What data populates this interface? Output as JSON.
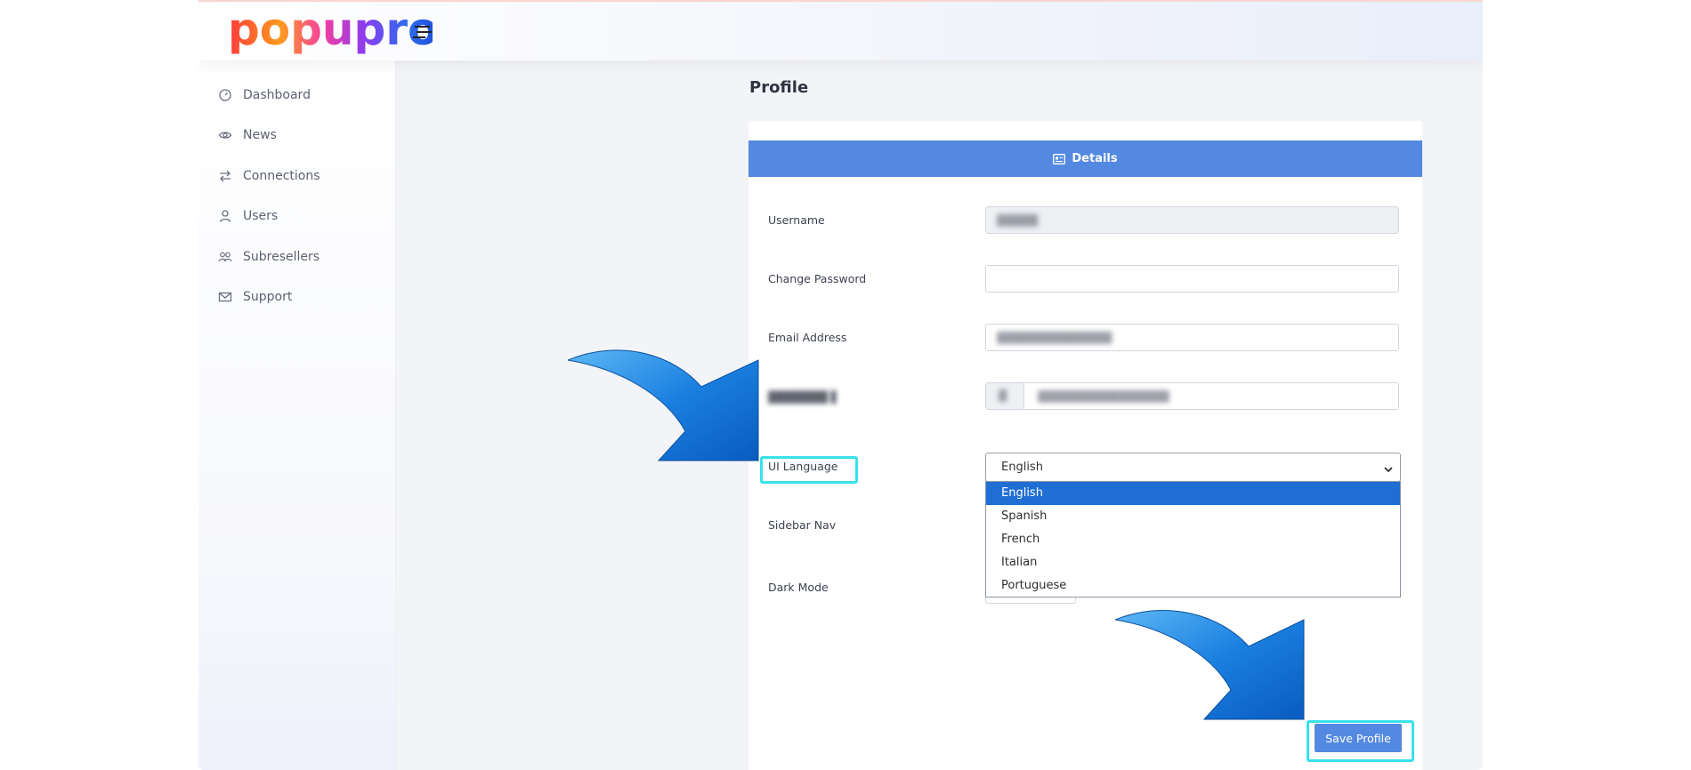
{
  "app": {
    "logo_text": "popupro"
  },
  "sidebar": {
    "items": [
      {
        "label": "Dashboard",
        "icon": "gauge-icon"
      },
      {
        "label": "News",
        "icon": "eye-icon"
      },
      {
        "label": "Connections",
        "icon": "arrows-swap-icon"
      },
      {
        "label": "Users",
        "icon": "user-icon"
      },
      {
        "label": "Subresellers",
        "icon": "users-icon"
      },
      {
        "label": "Support",
        "icon": "envelope-icon"
      }
    ]
  },
  "page": {
    "title": "Profile",
    "card_header": "Details"
  },
  "form": {
    "username_label": "Username",
    "username_value": "",
    "password_label": "Change Password",
    "password_value": "",
    "email_label": "Email Address",
    "email_value": "",
    "ui_language_label": "UI Language",
    "ui_language_value": "English",
    "language_options": [
      "English",
      "Spanish",
      "French",
      "Italian",
      "Portuguese"
    ],
    "sidebar_nav_label": "Sidebar Nav",
    "dark_mode_label": "Dark Mode",
    "save_label": "Save Profile"
  },
  "colors": {
    "accent": "#5489e1",
    "highlight": "#39e1ea",
    "selected_option": "#1f6ed4"
  }
}
